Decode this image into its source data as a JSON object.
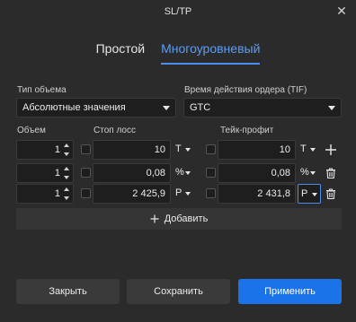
{
  "window": {
    "title": "SL/TP",
    "close_icon": "close-icon"
  },
  "tabs": [
    {
      "label": "Простой",
      "active": false
    },
    {
      "label": "Многоуровневый",
      "active": true
    }
  ],
  "volume_type": {
    "label": "Тип объема",
    "value": "Абсолютные значения"
  },
  "tif": {
    "label": "Время действия ордера (TIF)",
    "value": "GTC"
  },
  "columns": {
    "volume": "Объем",
    "stop_loss": "Стоп лосс",
    "take_profit": "Тейк-профит"
  },
  "rows": [
    {
      "volume": "1",
      "sl_value": "10",
      "sl_unit": "T",
      "tp_value": "10",
      "tp_unit": "T",
      "action_icon": "plus-icon"
    },
    {
      "volume": "1",
      "sl_value": "0,08",
      "sl_unit": "%",
      "tp_value": "0,08",
      "tp_unit": "%",
      "action_icon": "trash-icon"
    },
    {
      "volume": "1",
      "sl_value": "2 425,9",
      "sl_unit": "P",
      "tp_value": "2 431,8",
      "tp_unit": "P",
      "action_icon": "trash-icon"
    }
  ],
  "add_button": {
    "label": "Добавить",
    "icon": "plus-icon"
  },
  "footer": {
    "close_label": "Закрыть",
    "save_label": "Сохранить",
    "apply_label": "Применить"
  },
  "colors": {
    "accent": "#1a73e8",
    "tab_active": "#5b9df5",
    "background": "#2b2b2b"
  }
}
